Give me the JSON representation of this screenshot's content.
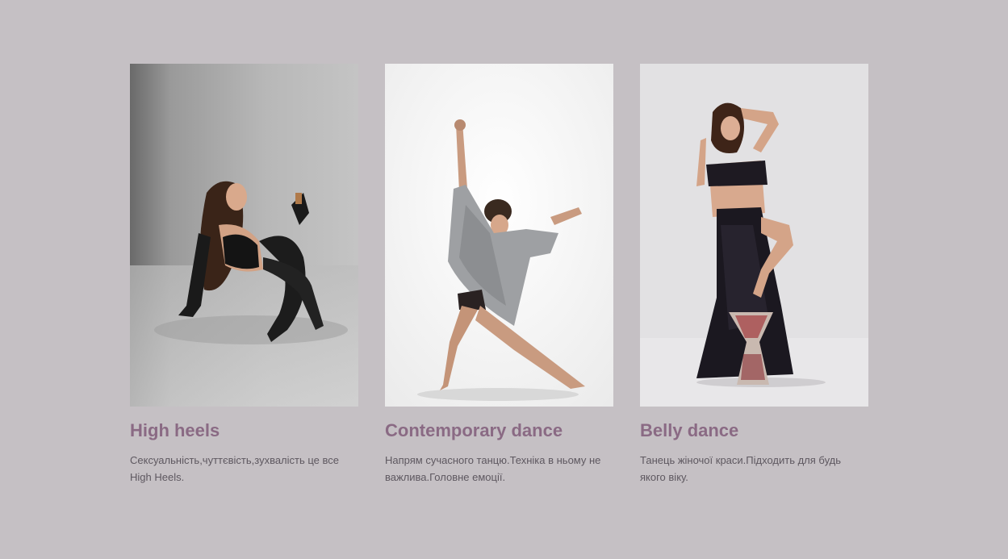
{
  "cards": [
    {
      "title": "High heels",
      "description": "Сексуальність,чуттєвість,зухвалість це все High Heels."
    },
    {
      "title": "Contemporary dance",
      "description": "Напрям сучасного танцю.Техніка в ньому не важлива.Головне емоції."
    },
    {
      "title": "Belly dance",
      "description": "Танець жіночої краси.Підходить для будь якого віку."
    }
  ],
  "colors": {
    "background": "#c5c0c4",
    "title": "#8a6a84",
    "text": "#5e5860"
  }
}
